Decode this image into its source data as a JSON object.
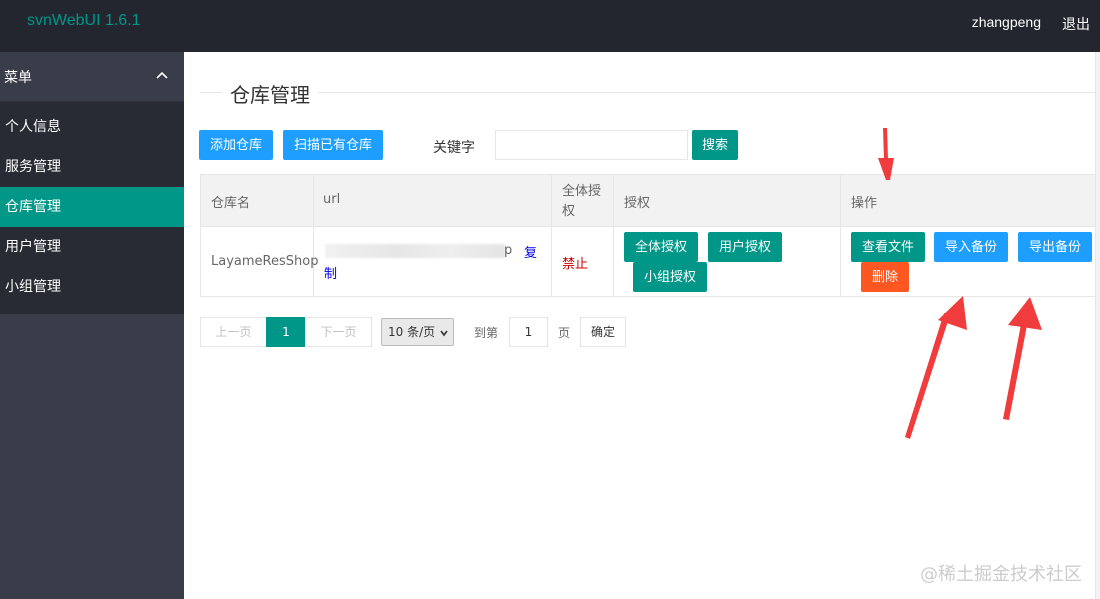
{
  "header": {
    "app_title": "svnWebUI 1.6.1",
    "username": "zhangpeng",
    "logout_label": "退出"
  },
  "sidebar": {
    "menu_title": "菜单",
    "items": [
      {
        "label": "个人信息",
        "active": false
      },
      {
        "label": "服务管理",
        "active": false
      },
      {
        "label": "仓库管理",
        "active": true
      },
      {
        "label": "用户管理",
        "active": false
      },
      {
        "label": "小组管理",
        "active": false
      }
    ]
  },
  "main": {
    "page_title": "仓库管理",
    "toolbar": {
      "add_label": "添加仓库",
      "scan_label": "扫描已有仓库",
      "keyword_label": "关键字",
      "keyword_value": "",
      "search_label": "搜索"
    },
    "table": {
      "headers": [
        "仓库名",
        "url",
        "全体授权",
        "授权",
        "操作"
      ],
      "rows": [
        {
          "name": "LayameResShop",
          "url_suffix": "p",
          "copy_label_1": "复",
          "copy_label_2": "制",
          "all_auth": "禁止",
          "auth_buttons": [
            "全体授权",
            "用户授权",
            "小组授权"
          ],
          "op_buttons": [
            "查看文件",
            "导入备份",
            "导出备份",
            "删除"
          ]
        }
      ]
    },
    "pagination": {
      "prev_label": "上一页",
      "current_page": "1",
      "next_label": "下一页",
      "page_size": "10 条/页",
      "goto_label": "到第",
      "goto_value": "1",
      "page_unit": "页",
      "confirm_label": "确定"
    }
  },
  "watermark": "@稀土掘金技术社区",
  "colors": {
    "header_bg": "#23262e",
    "sidebar_bg": "#393d49",
    "accent_green": "#009688",
    "accent_blue": "#1e9fff",
    "danger": "#ff5722",
    "annotation_red": "#f03c3c"
  }
}
